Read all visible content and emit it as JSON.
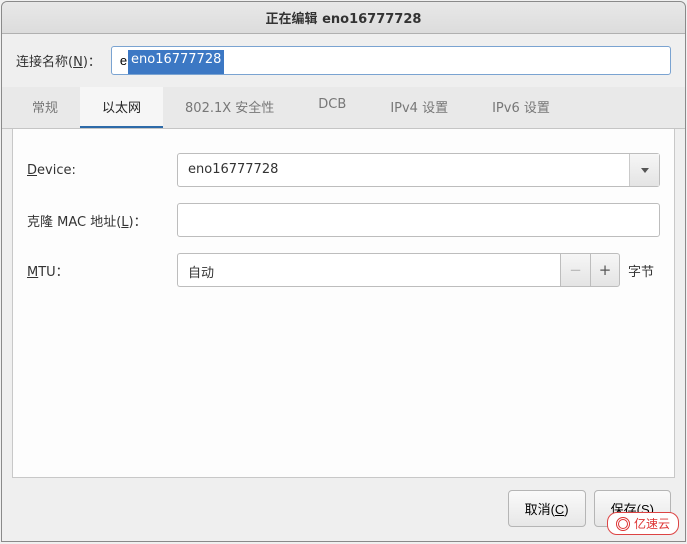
{
  "title": "正在编辑 eno16777728",
  "name_row": {
    "label_pre": "连接名称(",
    "label_accel": "N",
    "label_post": ")：",
    "value": "eno16777728"
  },
  "tabs": [
    {
      "label": "常规"
    },
    {
      "label": "以太网"
    },
    {
      "label": "802.1X 安全性"
    },
    {
      "label": "DCB"
    },
    {
      "label": "IPv4 设置"
    },
    {
      "label": "IPv6 设置"
    }
  ],
  "fields": {
    "device": {
      "label_pre": "",
      "label_accel": "D",
      "label_post": "evice:",
      "value": "eno16777728"
    },
    "clone_mac": {
      "label_pre": "克隆 MAC 地址(",
      "label_accel": "L",
      "label_post": ")：",
      "value": ""
    },
    "mtu": {
      "label_pre": "",
      "label_accel": "M",
      "label_post": "TU：",
      "value": "自动",
      "unit": "字节"
    }
  },
  "buttons": {
    "cancel_pre": "取消(",
    "cancel_accel": "C",
    "cancel_post": ")",
    "save_pre": "保存(",
    "save_accel": "S",
    "save_post": ")"
  },
  "watermark": "亿速云"
}
